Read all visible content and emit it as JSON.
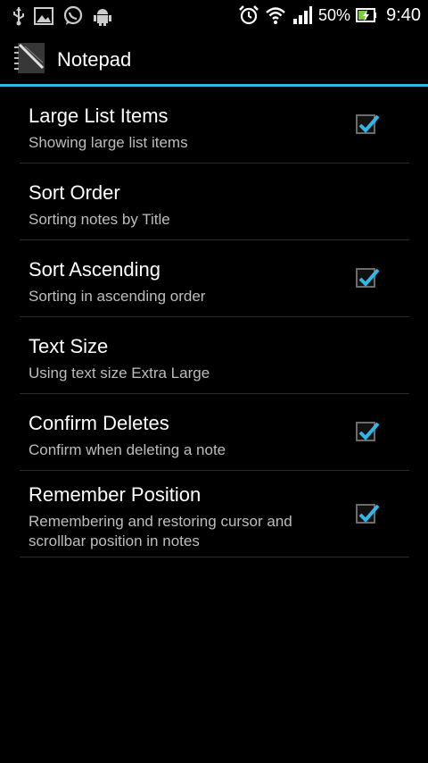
{
  "status_bar": {
    "left_icons": [
      "usb-icon",
      "image-icon",
      "whatsapp-icon",
      "android-icon"
    ],
    "right_icons": [
      "alarm-icon",
      "wifi-icon",
      "signal-icon",
      "battery-icon"
    ],
    "battery_percent": "50%",
    "time": "9:40"
  },
  "action_bar": {
    "title": "Notepad",
    "app_icon": "notepad-app-icon",
    "accent_color": "#33b5e5"
  },
  "preferences": [
    {
      "title": "Large List Items",
      "summary": "Showing large list items",
      "checkbox": true,
      "checked": true
    },
    {
      "title": "Sort Order",
      "summary": "Sorting notes by Title",
      "checkbox": false,
      "checked": false
    },
    {
      "title": "Sort Ascending",
      "summary": "Sorting in ascending order",
      "checkbox": true,
      "checked": true
    },
    {
      "title": "Text Size",
      "summary": "Using text size Extra Large",
      "checkbox": false,
      "checked": false
    },
    {
      "title": "Confirm Deletes",
      "summary": "Confirm when deleting a note",
      "checkbox": true,
      "checked": true
    },
    {
      "title": "Remember Position",
      "summary": "Remembering and restoring cursor and scrollbar position in notes",
      "checkbox": true,
      "checked": true
    }
  ]
}
